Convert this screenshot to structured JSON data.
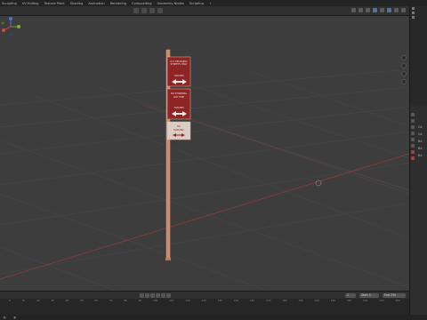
{
  "workspace_tabs": [
    "Sculpting",
    "UV Editing",
    "Texture Paint",
    "Shading",
    "Animation",
    "Rendering",
    "Compositing",
    "Geometry Nodes",
    "Scripting",
    "+"
  ],
  "sign": {
    "panel1_line1": "N 2 CROSSING",
    "panel1_line2": "STREETS ONLY",
    "panel1_line3": "7AM-9PM",
    "panel2_line1": "NO STANDING",
    "panel2_line2": "ANY TIME",
    "panel2_line3": "7AM-9PM",
    "panel3_line1": "NO",
    "panel3_line2": "PARKING"
  },
  "timeline": {
    "ruler": [
      "0",
      "10",
      "20",
      "30",
      "40",
      "50",
      "60",
      "70",
      "80",
      "90",
      "100",
      "110",
      "120",
      "130",
      "140",
      "150",
      "160",
      "170",
      "180",
      "190",
      "200",
      "210",
      "220",
      "230",
      "240",
      "250"
    ],
    "start_label": "Start",
    "start_value": "1",
    "end_label": "End",
    "end_value": "250",
    "current_frame": "1"
  },
  "properties": {
    "lines": [
      "Ca",
      "Ca",
      "Ba",
      "Ba",
      "Ba"
    ]
  },
  "colors": {
    "viewport_bg": "#3d3d3d",
    "grid_line": "#474747",
    "axis_x": "#8c3c3c",
    "pole": "#c88a6f",
    "sign_red": "#8e2424",
    "accent_blue": "#4772b3"
  }
}
